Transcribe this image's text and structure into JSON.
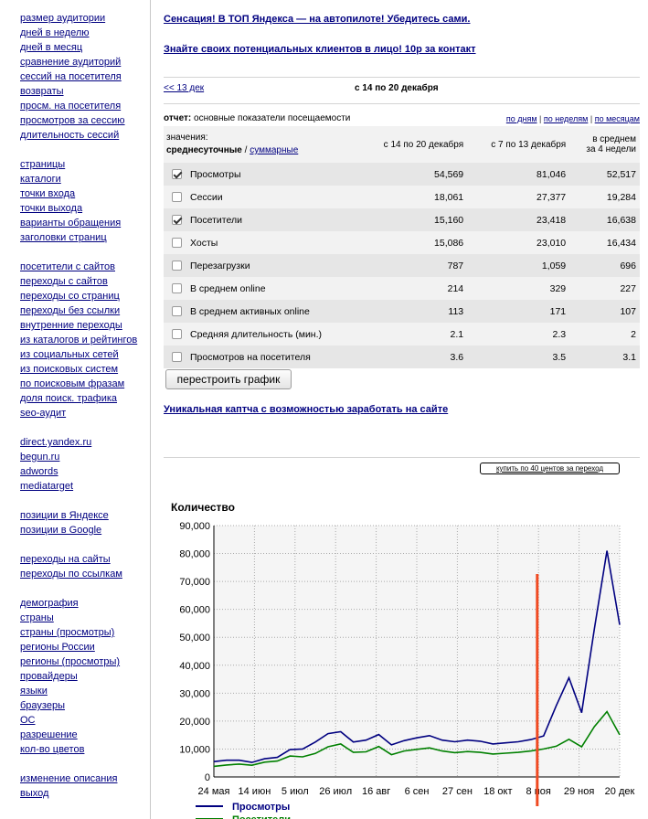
{
  "sidebar": {
    "groups": [
      [
        "размер аудитории",
        "дней в неделю",
        "дней в месяц",
        "сравнение аудиторий",
        "сессий на посетителя",
        "возвраты",
        "просм. на посетителя",
        "просмотров за сессию",
        "длительность сессий"
      ],
      [
        "страницы",
        "каталоги",
        "точки входа",
        "точки выхода",
        "варианты обращения",
        "заголовки страниц"
      ],
      [
        "посетители с сайтов",
        "переходы с сайтов",
        "переходы со страниц",
        "переходы без ссылки",
        "внутренние переходы",
        "из каталогов и рейтингов",
        "из социальных сетей",
        "из поисковых систем",
        "по поисковым фразам",
        "доля поиск. трафика",
        "seo-аудит"
      ],
      [
        "direct.yandex.ru",
        "begun.ru",
        "adwords",
        "mediatarget"
      ],
      [
        "позиции в Яндексе",
        "позиции в Google"
      ],
      [
        "переходы на сайты",
        "переходы по ссылкам"
      ],
      [
        "демография",
        "страны",
        "страны (просмотры)",
        "регионы России",
        "регионы (просмотры)",
        "провайдеры",
        "языки",
        "браузеры",
        "ОС",
        "разрешение",
        "кол-во цветов"
      ],
      [
        "изменение описания",
        "выход"
      ]
    ]
  },
  "ads": {
    "ad1": "Сенсация! В ТОП Яндекса — на автопилоте! Убедитесь сами.",
    "ad2": "Знайте своих потенциальных клиентов в лицо! 10р за контакт",
    "ad3": "Уникальная каптча с возможностью заработать на сайте"
  },
  "nav": {
    "prev": "<< 13 дек",
    "range": "с 14 по 20 декабря"
  },
  "report": {
    "label": "отчет:",
    "title": "основные показатели посещаемости",
    "period_links": [
      "по дням",
      "по неделям",
      "по месяцам"
    ],
    "sep": "|"
  },
  "table": {
    "values_label": "значения:",
    "mode_daily": "среднесуточные",
    "mode_sep": "/",
    "mode_total": "суммарные",
    "col1": "с 14 по 20 декабря",
    "col2": "с 7 по 13 декабря",
    "col3_line1": "в среднем",
    "col3_line2": "за 4 недели",
    "rows": [
      {
        "name": "Просмотры",
        "checked": true,
        "v1": "54,569",
        "v2": "81,046",
        "v3": "52,517"
      },
      {
        "name": "Сессии",
        "checked": false,
        "v1": "18,061",
        "v2": "27,377",
        "v3": "19,284"
      },
      {
        "name": "Посетители",
        "checked": true,
        "v1": "15,160",
        "v2": "23,418",
        "v3": "16,638"
      },
      {
        "name": "Хосты",
        "checked": false,
        "v1": "15,086",
        "v2": "23,010",
        "v3": "16,434"
      },
      {
        "name": "Перезагрузки",
        "checked": false,
        "v1": "787",
        "v2": "1,059",
        "v3": "696"
      },
      {
        "name": "В среднем online",
        "checked": false,
        "v1": "214",
        "v2": "329",
        "v3": "227"
      },
      {
        "name": "В среднем активных online",
        "checked": false,
        "v1": "113",
        "v2": "171",
        "v3": "107"
      },
      {
        "name": "Средняя длительность (мин.)",
        "checked": false,
        "v1": "2.1",
        "v2": "2.3",
        "v3": "2"
      },
      {
        "name": "Просмотров на посетителя",
        "checked": false,
        "v1": "3.6",
        "v2": "3.5",
        "v3": "3.1"
      }
    ]
  },
  "buttons": {
    "rebuild": "перестроить график",
    "buy": "купить по 40 центов за переход"
  },
  "chart_data": {
    "type": "line",
    "title": "Количество",
    "ylim": [
      0,
      90000
    ],
    "yticks": [
      "0",
      "10,000",
      "20,000",
      "30,000",
      "40,000",
      "50,000",
      "60,000",
      "70,000",
      "80,000",
      "90,000"
    ],
    "xticks": [
      "24 мая",
      "14 июн",
      "5 июл",
      "26 июл",
      "16 авг",
      "6 сен",
      "27 сен",
      "18 окт",
      "8 ноя",
      "29 ноя",
      "20 дек"
    ],
    "marker_week": 25.5,
    "series": [
      {
        "name": "Просмотры",
        "color": "#000080",
        "values": [
          5500,
          6000,
          6000,
          5200,
          6500,
          7000,
          9800,
          10000,
          12500,
          15500,
          16200,
          12500,
          13200,
          15200,
          11500,
          13000,
          14000,
          14800,
          13200,
          12600,
          13200,
          12800,
          11800,
          12200,
          12600,
          13400,
          14700,
          25500,
          35500,
          23000,
          53000,
          81000,
          54500
        ]
      },
      {
        "name": "Посетители",
        "color": "#008000",
        "values": [
          3800,
          4300,
          4600,
          4200,
          5300,
          5700,
          7500,
          7200,
          8400,
          10800,
          11800,
          8800,
          9000,
          10900,
          8000,
          9300,
          9900,
          10400,
          9300,
          8700,
          9100,
          8800,
          8200,
          8500,
          8800,
          9300,
          10000,
          11000,
          13500,
          10800,
          18000,
          23400,
          15100
        ]
      }
    ]
  }
}
